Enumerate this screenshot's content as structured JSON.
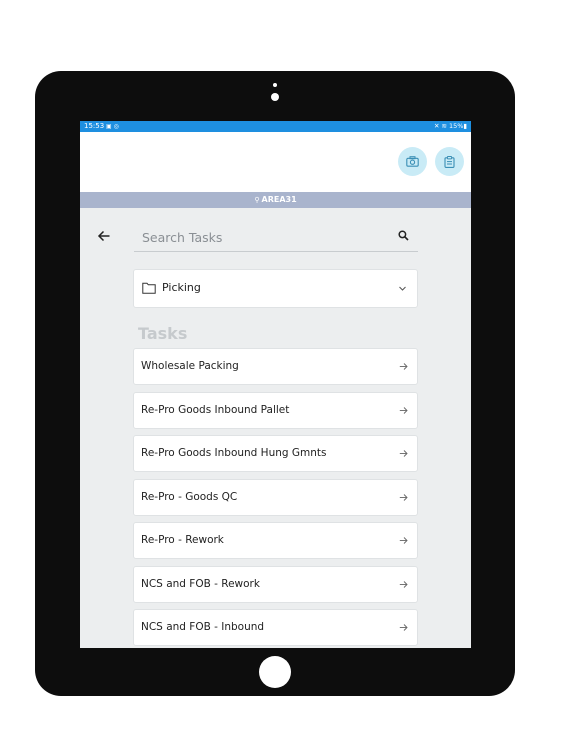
{
  "status_bar": {
    "time": "15:53",
    "left_icons": "▣ ◎",
    "right_icons": "✕ ≋ 15%▮"
  },
  "header": {
    "camera_icon": "camera-icon",
    "clipboard_icon": "clipboard-icon",
    "accent_color": "#c9ebf6"
  },
  "location": {
    "name": "AREA31",
    "bar_color": "#a9b4cd"
  },
  "search": {
    "placeholder": "Search Tasks",
    "value": ""
  },
  "category": {
    "selected": "Picking"
  },
  "tasks_section": {
    "title": "Tasks"
  },
  "tasks": [
    "Wholesale Packing",
    "Re-Pro Goods Inbound Pallet",
    "Re-Pro Goods Inbound Hung Gmnts",
    "Re-Pro - Goods QC",
    "Re-Pro - Rework",
    "NCS and FOB - Rework",
    "NCS and FOB - Inbound"
  ]
}
